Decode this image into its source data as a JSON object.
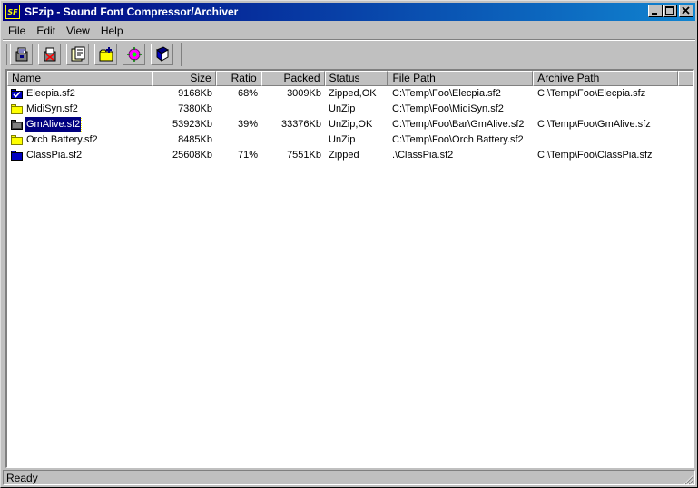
{
  "window": {
    "title": "SFzip - Sound Font Compressor/Archiver",
    "app_icon_text": "SF"
  },
  "menu": [
    "File",
    "Edit",
    "View",
    "Help"
  ],
  "toolbar": {
    "buttons": [
      "compress-icon",
      "decompress-icon",
      "properties-icon",
      "add-files-icon",
      "settings-icon",
      "help-book-icon"
    ]
  },
  "columns": [
    "Name",
    "Size",
    "Ratio",
    "Packed",
    "Status",
    "File Path",
    "Archive Path"
  ],
  "rows": [
    {
      "icon": "zipped-check-icon",
      "name": "Elecpia.sf2",
      "size": "9168Kb",
      "ratio": "68%",
      "packed": "3009Kb",
      "status": "Zipped,OK",
      "file_path": "C:\\Temp\\Foo\\Elecpia.sf2",
      "archive_path": "C:\\Temp\\Foo\\Elecpia.sfz",
      "selected": false
    },
    {
      "icon": "folder-icon",
      "name": "MidiSyn.sf2",
      "size": "7380Kb",
      "ratio": "",
      "packed": "",
      "status": "UnZip",
      "file_path": "C:\\Temp\\Foo\\MidiSyn.sf2",
      "archive_path": "",
      "selected": false
    },
    {
      "icon": "folder-dark-icon",
      "name": "GmAlive.sf2",
      "size": "53923Kb",
      "ratio": "39%",
      "packed": "33376Kb",
      "status": "UnZip,OK",
      "file_path": "C:\\Temp\\Foo\\Bar\\GmAlive.sf2",
      "archive_path": "C:\\Temp\\Foo\\GmAlive.sfz",
      "selected": true
    },
    {
      "icon": "folder-icon",
      "name": "Orch Battery.sf2",
      "size": "8485Kb",
      "ratio": "",
      "packed": "",
      "status": "UnZip",
      "file_path": "C:\\Temp\\Foo\\Orch Battery.sf2",
      "archive_path": "",
      "selected": false
    },
    {
      "icon": "folder-blue-icon",
      "name": "ClassPia.sf2",
      "size": "25608Kb",
      "ratio": "71%",
      "packed": "7551Kb",
      "status": "Zipped",
      "file_path": ".\\ClassPia.sf2",
      "archive_path": "C:\\Temp\\Foo\\ClassPia.sfz",
      "selected": false
    }
  ],
  "status_bar": {
    "text": "Ready"
  },
  "colors": {
    "title_start": "#000080",
    "title_end": "#1084d0",
    "selection": "#000080",
    "folder": "#ffff00",
    "face": "#c0c0c0"
  }
}
